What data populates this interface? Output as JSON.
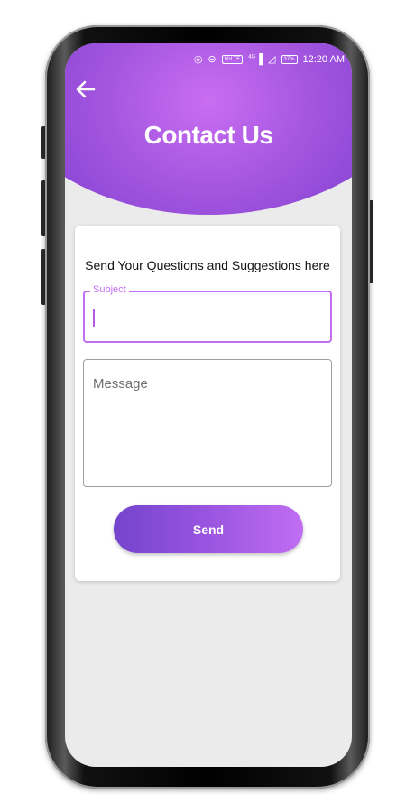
{
  "status_bar": {
    "volte": "VoLTE",
    "signal": "4G",
    "battery": "37%",
    "time": "12:20 AM"
  },
  "header": {
    "back_icon": "arrow-left-icon",
    "title": "Contact Us",
    "gradient_colors": [
      "#6c35c6",
      "#c96df2"
    ]
  },
  "form": {
    "heading": "Send Your Questions and Suggestions here",
    "subject_label": "Subject",
    "subject_value": "",
    "message_placeholder": "Message",
    "message_value": "",
    "send_label": "Send",
    "accent_color": "#c46ef2"
  }
}
